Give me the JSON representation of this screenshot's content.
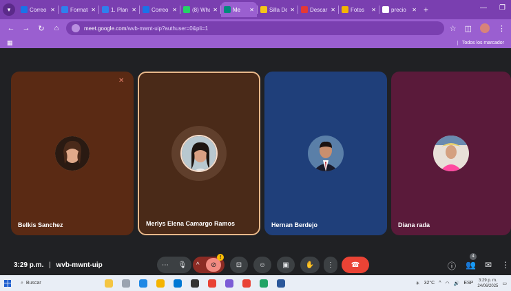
{
  "browser": {
    "tabs": [
      {
        "label": "Correo",
        "color": "#1a73e8"
      },
      {
        "label": "Formato",
        "color": "#2f80ed"
      },
      {
        "label": "1. Plan",
        "color": "#2f80ed"
      },
      {
        "label": "Correo",
        "color": "#1a73e8"
      },
      {
        "label": "(8) Wha",
        "color": "#25d366"
      },
      {
        "label": "Me",
        "color": "#00897b",
        "active": true
      },
      {
        "label": "Silla De",
        "color": "#f5c518"
      },
      {
        "label": "Descar",
        "color": "#e53935"
      },
      {
        "label": "Fotos",
        "color": "#f4b400"
      },
      {
        "label": "precio",
        "color": "#ffffff"
      }
    ],
    "new_tab": "+",
    "url_host": "meet.google.com",
    "url_path": "/wvb-mwnt-uip?authuser=0&pli=1",
    "bookmarks_all": "Todos los marcador"
  },
  "participants": [
    {
      "name": "Belkis Sanchez",
      "bg": "#5a2a14",
      "muted": true
    },
    {
      "name": "Merlys Elena Camargo Ramos",
      "bg": "#4a2a18",
      "speaking": true
    },
    {
      "name": "Hernan Berdejo",
      "bg": "#1f3f7a"
    },
    {
      "name": "Diana rada",
      "bg": "#5a1a3a"
    }
  ],
  "meeting": {
    "time": "3:29 p.m.",
    "separator": "|",
    "code": "wvb-mwnt-uip",
    "notification_count": "!",
    "people_count": "4"
  },
  "taskbar": {
    "search_placeholder": "Buscar",
    "temperature": "32°C",
    "language": "ESP",
    "clock_time": "3:29 p. m.",
    "clock_date": "24/06/2025"
  }
}
